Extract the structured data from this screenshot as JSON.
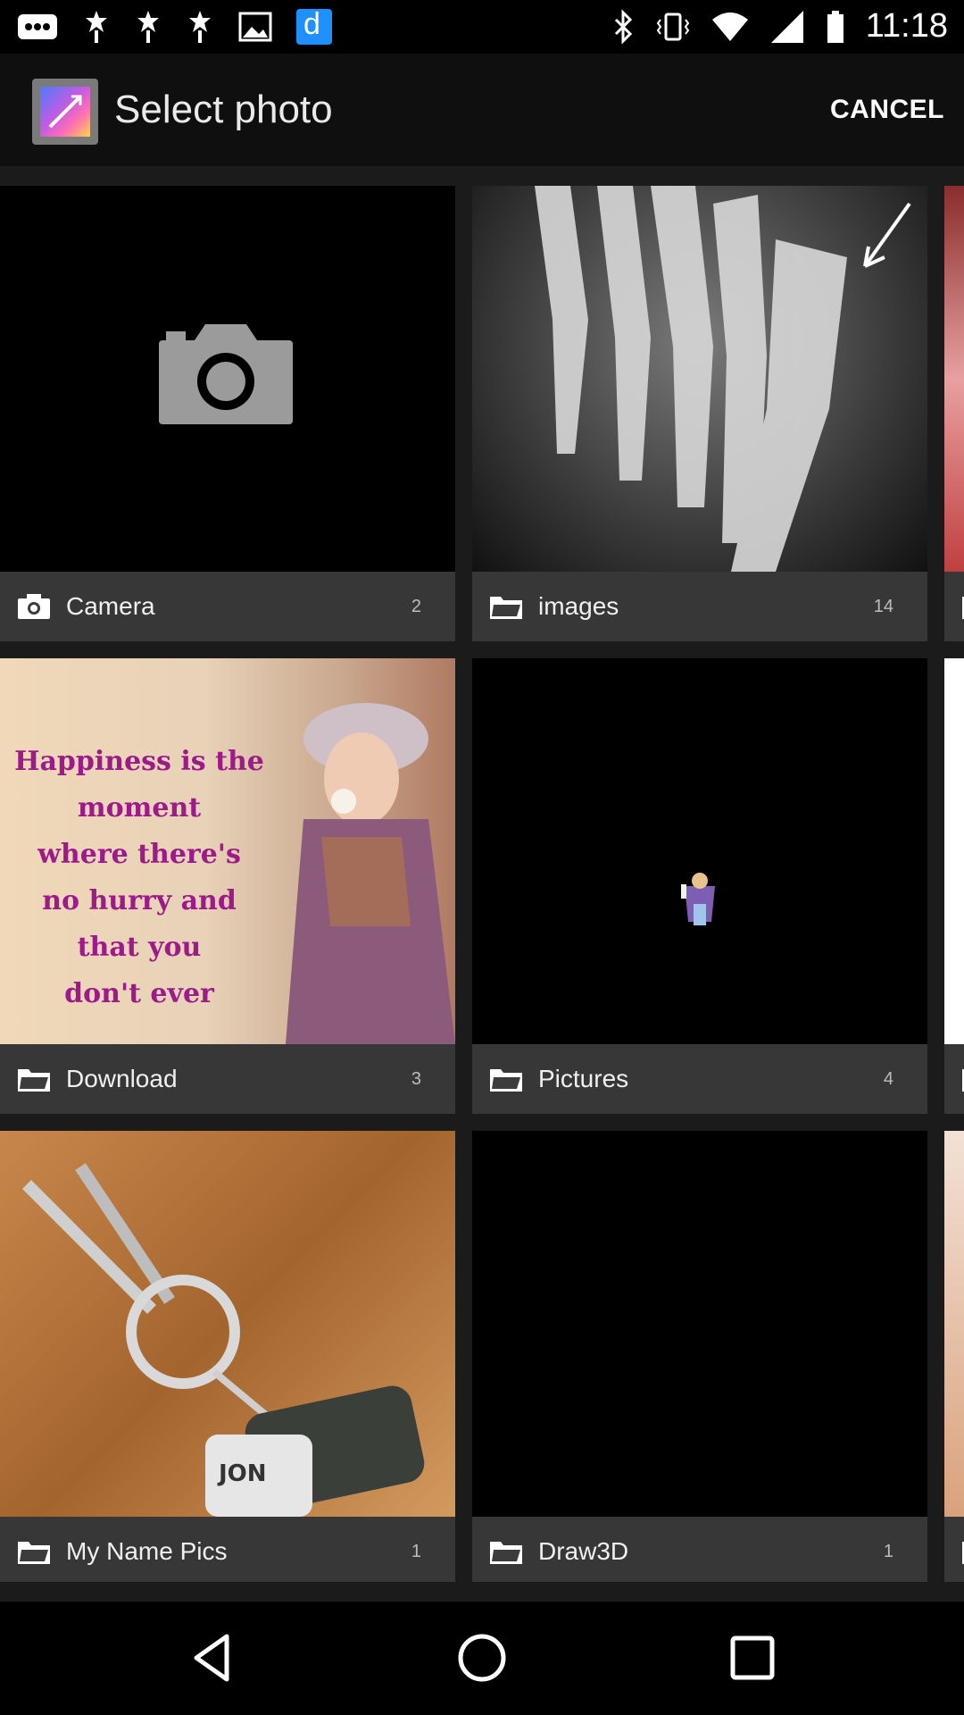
{
  "status_bar": {
    "time": "11:18",
    "left_icons": [
      "more-icon",
      "notification-icon",
      "notification-icon",
      "notification-icon",
      "image-icon",
      "app-icon"
    ],
    "right_icons": [
      "bluetooth-icon",
      "vibrate-icon",
      "wifi-icon",
      "signal-icon",
      "battery-icon"
    ]
  },
  "app_bar": {
    "title": "Select photo",
    "cancel_label": "CANCEL",
    "icon": "gallery-icon"
  },
  "albums": [
    {
      "name": "Camera",
      "count": "2",
      "icon": "camera-icon",
      "thumb": "camera-placeholder"
    },
    {
      "name": "images",
      "count": "14",
      "icon": "folder-icon",
      "thumb": "foot-xray"
    },
    {
      "name": "",
      "count": "",
      "icon": "folder-icon",
      "thumb": "partial"
    },
    {
      "name": "Download",
      "count": "3",
      "icon": "folder-icon",
      "thumb": "quote-girl"
    },
    {
      "name": "Pictures",
      "count": "4",
      "icon": "folder-icon",
      "thumb": "small-figure"
    },
    {
      "name": "",
      "count": "",
      "icon": "folder-icon",
      "thumb": "partial-white"
    },
    {
      "name": "My Name Pics",
      "count": "1",
      "icon": "folder-icon",
      "thumb": "keys"
    },
    {
      "name": "Draw3D",
      "count": "1",
      "icon": "folder-icon",
      "thumb": "black"
    },
    {
      "name": "",
      "count": "",
      "icon": "folder-icon",
      "thumb": "partial"
    }
  ],
  "thumb_text": {
    "quote": [
      "Happiness is the",
      "moment",
      "where there's",
      "no hurry and",
      "that you",
      "don't ever"
    ],
    "keytag": "JON"
  },
  "nav_bar": {
    "buttons": [
      "back-icon",
      "home-icon",
      "recents-icon"
    ]
  },
  "colors": {
    "background": "#1b1b1b",
    "app_bar": "#0f0f0f",
    "label_bar": "#3c3c3c",
    "notification_accent": "#1e90ff"
  }
}
